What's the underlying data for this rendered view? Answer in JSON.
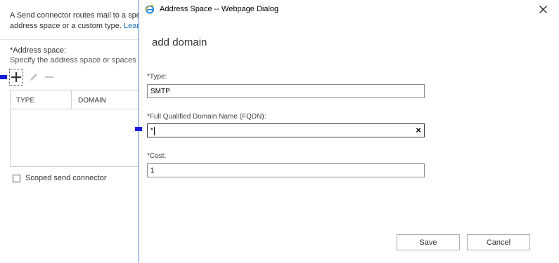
{
  "background_page": {
    "intro_line1": "A Send connector routes mail to a spe",
    "intro_line2": "address space or a custom type. ",
    "intro_link": "Learn",
    "address_space_label": "*Address space:",
    "address_space_help": "Specify the address space or spaces to",
    "toolbar": {
      "add_icon": "plus-icon",
      "edit_icon": "pencil-icon",
      "remove_icon": "minus-icon"
    },
    "grid": {
      "columns": [
        "TYPE",
        "DOMAIN"
      ],
      "rows": []
    },
    "scoped_checkbox": {
      "label": "Scoped send connector",
      "checked": false
    }
  },
  "dialog": {
    "title": "Address Space -- Webpage Dialog",
    "heading": "add domain",
    "fields": {
      "type": {
        "label": "*Type:",
        "value": "SMTP"
      },
      "fqdn": {
        "label": "*Full Qualified Domain Name (FQDN):",
        "value": "*"
      },
      "cost": {
        "label": "*Cost:",
        "value": "1"
      }
    },
    "save_label": "Save",
    "cancel_label": "Cancel"
  },
  "colors": {
    "marker": "#1a1adc",
    "link": "#1a6fb5",
    "dialog_border": "#4f86c6"
  }
}
